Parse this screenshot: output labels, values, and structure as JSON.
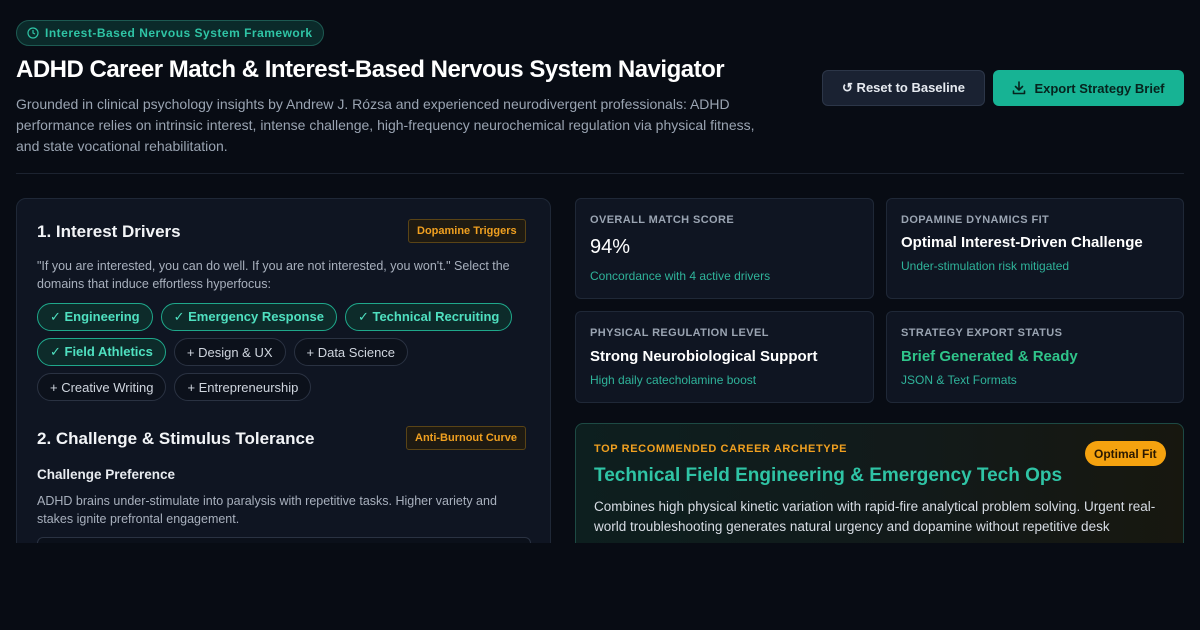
{
  "header": {
    "badge": "Interest-Based Nervous System Framework",
    "title": "ADHD Career Match & Interest-Based Nervous System Navigator",
    "subtitle": "Grounded in clinical psychology insights by Andrew J. Rózsa and experienced neurodivergent professionals: ADHD performance relies on intrinsic interest, intense challenge, high-frequency neurochemical regulation via physical fitness, and state vocational rehabilitation.",
    "reset_label": "↺ Reset to Baseline",
    "export_label": "Export Strategy Brief"
  },
  "interest_drivers": {
    "title": "1. Interest Drivers",
    "tag": "Dopamine Triggers",
    "description": "\"If you are interested, you can do well. If you are not interested, you won't.\" Select the domains that induce effortless hyperfocus:",
    "chips": [
      {
        "label": "✓ Engineering",
        "selected": true
      },
      {
        "label": "✓ Emergency Response",
        "selected": true
      },
      {
        "label": "✓ Technical Recruiting",
        "selected": true
      },
      {
        "label": "✓ Field Athletics",
        "selected": true
      },
      {
        "label": "+ Design & UX",
        "selected": false
      },
      {
        "label": "+ Data Science",
        "selected": false
      },
      {
        "label": "+ Creative Writing",
        "selected": false
      },
      {
        "label": "+ Entrepreneurship",
        "selected": false
      }
    ]
  },
  "challenge": {
    "title": "2. Challenge & Stimulus Tolerance",
    "tag": "Anti-Burnout Curve",
    "sub_label": "Challenge Preference",
    "description": "ADHD brains under-stimulate into paralysis with repetitive tasks. Higher variety and stakes ignite prefrontal engagement."
  },
  "stats": {
    "match": {
      "label": "OVERALL MATCH SCORE",
      "value": "94%",
      "note": "Concordance with 4 active drivers"
    },
    "dopamine": {
      "label": "DOPAMINE DYNAMICS FIT",
      "value": "Optimal Interest-Driven Challenge",
      "note": "Under-stimulation risk mitigated"
    },
    "physical": {
      "label": "PHYSICAL REGULATION LEVEL",
      "value": "Strong Neurobiological Support",
      "note": "High daily catecholamine boost"
    },
    "export": {
      "label": "STRATEGY EXPORT STATUS",
      "value": "Brief Generated & Ready",
      "note": "JSON & Text Formats"
    }
  },
  "recommendation": {
    "label": "TOP RECOMMENDED CAREER ARCHETYPE",
    "badge": "Optimal Fit",
    "title": "Technical Field Engineering & Emergency Tech Ops",
    "description": "Combines high physical kinetic variation with rapid-fire analytical problem solving. Urgent real-world troubleshooting generates natural urgency and dopamine without repetitive desk"
  },
  "colors": {
    "accent": "#17b394",
    "amber": "#f0a020",
    "background": "#080c14"
  }
}
